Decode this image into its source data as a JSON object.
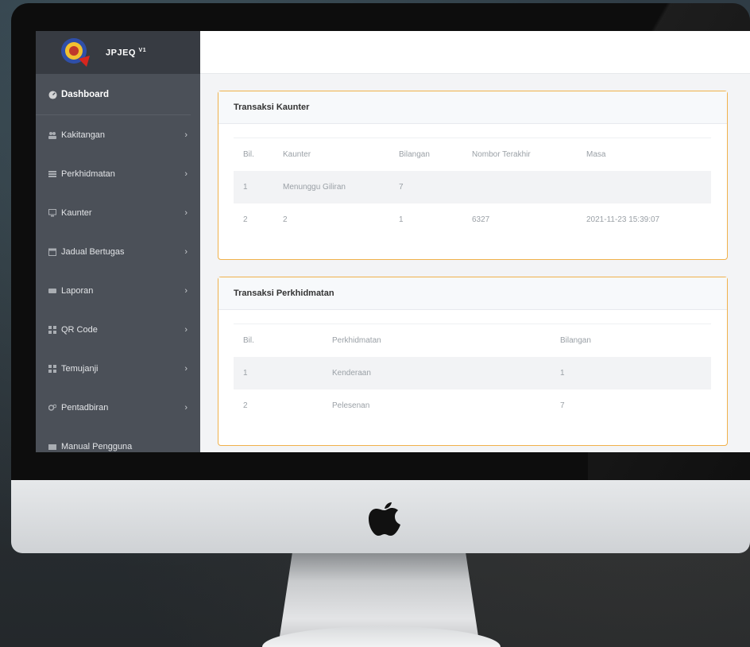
{
  "app": {
    "brand": "JPJEQ",
    "version": "V1"
  },
  "sidebar": {
    "dashboard_label": "Dashboard",
    "items": [
      {
        "label": "Kakitangan",
        "icon": "users-icon"
      },
      {
        "label": "Perkhidmatan",
        "icon": "list-icon"
      },
      {
        "label": "Kaunter",
        "icon": "monitor-icon"
      },
      {
        "label": "Jadual Bertugas",
        "icon": "calendar-icon"
      },
      {
        "label": "Laporan",
        "icon": "report-icon"
      },
      {
        "label": "QR Code",
        "icon": "qrcode-icon"
      },
      {
        "label": "Temujanji",
        "icon": "grid-icon"
      },
      {
        "label": "Pentadbiran",
        "icon": "settings-icon"
      },
      {
        "label": "Manual Pengguna",
        "icon": "book-icon"
      }
    ]
  },
  "kaunter_card": {
    "title": "Transaksi Kaunter",
    "headers": [
      "Bil.",
      "Kaunter",
      "Bilangan",
      "Nombor Terakhir",
      "Masa"
    ],
    "rows": [
      [
        "1",
        "Menunggu Giliran",
        "7",
        "",
        ""
      ],
      [
        "2",
        "2",
        "1",
        "6327",
        "2021-11-23 15:39:07"
      ]
    ]
  },
  "perkhidmatan_card": {
    "title": "Transaksi Perkhidmatan",
    "headers": [
      "Bil.",
      "Perkhidmatan",
      "Bilangan"
    ],
    "rows": [
      [
        "1",
        "Kenderaan",
        "1"
      ],
      [
        "2",
        "Pelesenan",
        "7"
      ]
    ]
  },
  "colors": {
    "sidebar_bg": "#4b5058",
    "card_border": "#f0b14b"
  }
}
